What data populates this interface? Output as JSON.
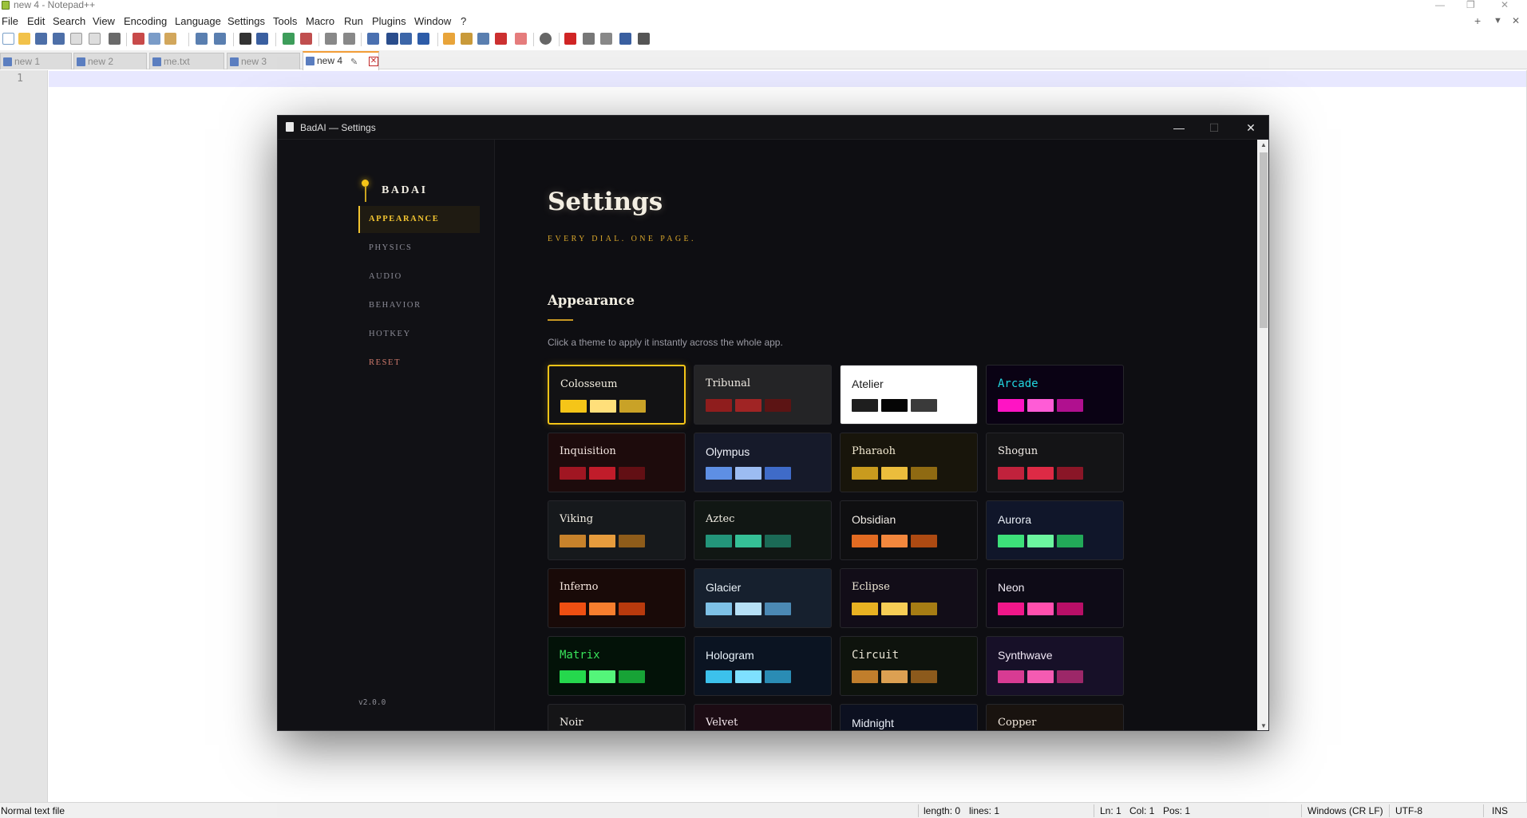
{
  "npp": {
    "title": "new 4 - Notepad++",
    "menu": [
      "File",
      "Edit",
      "Search",
      "View",
      "Encoding",
      "Language",
      "Settings",
      "Tools",
      "Macro",
      "Run",
      "Plugins",
      "Window",
      "?"
    ],
    "menu_right": [
      "+",
      "▼",
      "✕"
    ],
    "tabs": [
      "new 1",
      "new 2",
      "me.txt",
      "new 3",
      "new 4"
    ],
    "active_tab": "new 4",
    "line_number": "1",
    "status": {
      "filetype": "Normal text file",
      "length": "length: 0",
      "lines": "lines: 1",
      "ln": "Ln: 1",
      "col": "Col: 1",
      "pos": "Pos: 1",
      "eol": "Windows (CR LF)",
      "encoding": "UTF-8",
      "mode": "INS"
    }
  },
  "badai": {
    "window_title": "BadAI — Settings",
    "brand": "BADAI",
    "nav": [
      "APPEARANCE",
      "PHYSICS",
      "AUDIO",
      "BEHAVIOR",
      "HOTKEY",
      "RESET"
    ],
    "version": "v2.0.0",
    "page_title": "Settings",
    "page_subtitle": "EVERY DIAL. ONE PAGE.",
    "section_title": "Appearance",
    "section_desc": "Click a theme to apply it instantly across the whole app.",
    "selected_theme": "Colosseum",
    "themes": [
      {
        "name": "Colosseum",
        "bg": "#121214",
        "fg": "#f3eee0",
        "swatches": [
          "#f5c518",
          "#ffdf7a",
          "#c9a227"
        ]
      },
      {
        "name": "Tribunal",
        "bg": "#242426",
        "fg": "#f0ebe3",
        "swatches": [
          "#8f1d1d",
          "#a02424",
          "#5c1414"
        ]
      },
      {
        "name": "Atelier",
        "bg": "#ffffff",
        "fg": "#1b1b1b",
        "swatches": [
          "#1e1e1e",
          "#050505",
          "#3a3a3a"
        ]
      },
      {
        "name": "Arcade",
        "bg": "#0a0214",
        "fg": "#22d6e0",
        "swatches": [
          "#ff14c4",
          "#ff5cd6",
          "#b0108f"
        ]
      },
      {
        "name": "Inquisition",
        "bg": "#1d0b0c",
        "fg": "#f1e4df",
        "swatches": [
          "#a01622",
          "#c01c2a",
          "#620f14"
        ]
      },
      {
        "name": "Olympus",
        "bg": "#161a2a",
        "fg": "#eef0f8",
        "swatches": [
          "#5e8fe4",
          "#9cbcf2",
          "#3f6bc8"
        ]
      },
      {
        "name": "Pharaoh",
        "bg": "#18150b",
        "fg": "#f3ead2",
        "swatches": [
          "#c99b1e",
          "#ebbd3c",
          "#8f6a12"
        ]
      },
      {
        "name": "Shogun",
        "bg": "#141416",
        "fg": "#f1ebe6",
        "swatches": [
          "#c0223c",
          "#dd2a45",
          "#8a1627"
        ]
      },
      {
        "name": "Viking",
        "bg": "#16191c",
        "fg": "#f0ebe0",
        "swatches": [
          "#c7822b",
          "#e69c3d",
          "#8e5c1a"
        ]
      },
      {
        "name": "Aztec",
        "bg": "#111714",
        "fg": "#f0ece2",
        "swatches": [
          "#23957a",
          "#35c096",
          "#1b6a56"
        ]
      },
      {
        "name": "Obsidian",
        "bg": "#0f0f11",
        "fg": "#efeae4",
        "swatches": [
          "#e26b22",
          "#f2873d",
          "#ad4a12"
        ]
      },
      {
        "name": "Aurora",
        "bg": "#10162a",
        "fg": "#e9eef5",
        "swatches": [
          "#3de07a",
          "#6cf59f",
          "#22a858"
        ]
      },
      {
        "name": "Inferno",
        "bg": "#190a08",
        "fg": "#f5e6de",
        "swatches": [
          "#ef4f12",
          "#f77e2e",
          "#b83a0d"
        ]
      },
      {
        "name": "Glacier",
        "bg": "#16202e",
        "fg": "#e9f1f7",
        "swatches": [
          "#7ec1e6",
          "#b6e0f6",
          "#4b89b4"
        ]
      },
      {
        "name": "Eclipse",
        "bg": "#120d18",
        "fg": "#f1ead8",
        "swatches": [
          "#e8b222",
          "#f6cd55",
          "#a67c14"
        ]
      },
      {
        "name": "Neon",
        "bg": "#0e0b17",
        "fg": "#f0eaf4",
        "swatches": [
          "#f0178a",
          "#ff4fae",
          "#b80f67"
        ]
      },
      {
        "name": "Matrix",
        "bg": "#031208",
        "fg": "#39e25a",
        "swatches": [
          "#25d84d",
          "#54f57a",
          "#17a336"
        ]
      },
      {
        "name": "Hologram",
        "bg": "#0b1422",
        "fg": "#e8f2fa",
        "swatches": [
          "#3cc1ec",
          "#7ee0ff",
          "#2a8cb4"
        ]
      },
      {
        "name": "Circuit",
        "bg": "#0e130d",
        "fg": "#e9e4d4",
        "swatches": [
          "#c07e2c",
          "#dca052",
          "#8c5a1c"
        ]
      },
      {
        "name": "Synthwave",
        "bg": "#171028",
        "fg": "#f2e9f6",
        "swatches": [
          "#d83b93",
          "#f45bb2",
          "#9c2768"
        ]
      },
      {
        "name": "Noir",
        "bg": "#151517",
        "fg": "#f3efe8",
        "swatches": []
      },
      {
        "name": "Velvet",
        "bg": "#1c0c14",
        "fg": "#f5e8ee",
        "swatches": []
      },
      {
        "name": "Midnight",
        "bg": "#0c1020",
        "fg": "#e9edf6",
        "swatches": []
      },
      {
        "name": "Copper",
        "bg": "#19130f",
        "fg": "#f4eadf",
        "swatches": []
      }
    ]
  },
  "colors": {
    "accent": "#f5c518",
    "npp_tab_accent": "#f29d38",
    "window_bg": "#0e0e12"
  },
  "icons": [
    "search-icon",
    "close-icon",
    "pin-icon",
    "minimize-icon",
    "maximize-icon"
  ]
}
